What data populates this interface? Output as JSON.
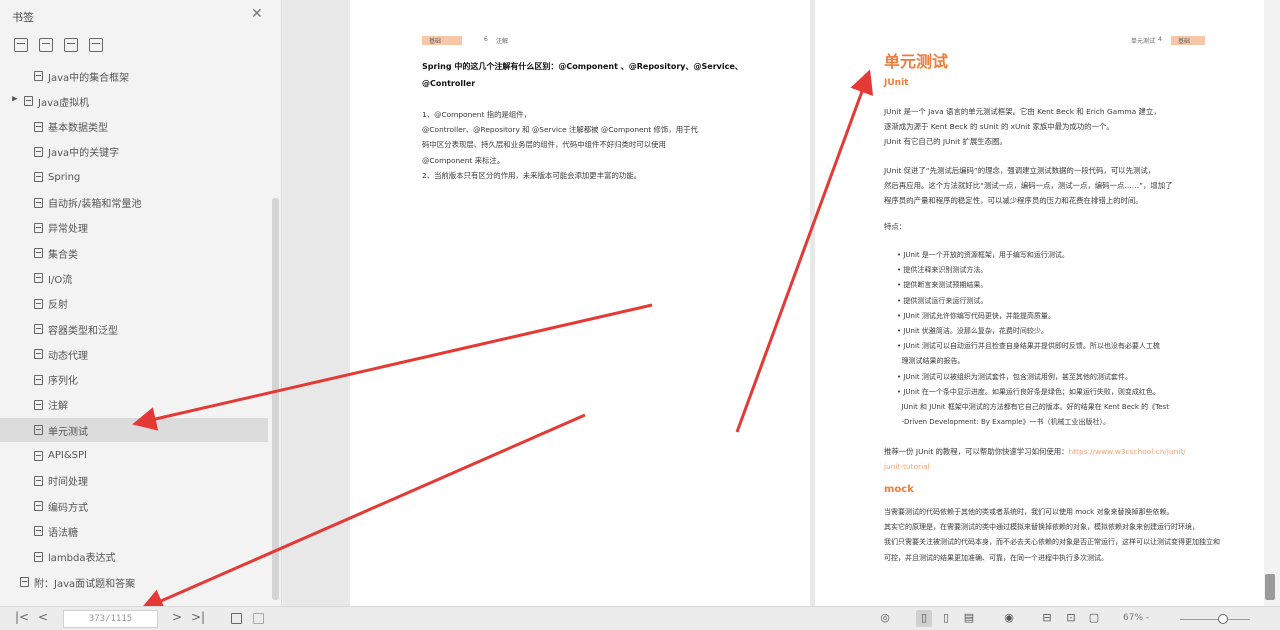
{
  "sidebar": {
    "title": "书签",
    "items": [
      {
        "label": "Java中的集合框架",
        "indent": 1
      },
      {
        "label": "Java虚拟机",
        "indent": 0
      },
      {
        "label": "基本数据类型",
        "indent": 1
      },
      {
        "label": "Java中的关键字",
        "indent": 1
      },
      {
        "label": "Spring",
        "indent": 1
      },
      {
        "label": "自动拆/装箱和常量池",
        "indent": 1
      },
      {
        "label": "异常处理",
        "indent": 1
      },
      {
        "label": "集合类",
        "indent": 1
      },
      {
        "label": "I/O流",
        "indent": 1
      },
      {
        "label": "反射",
        "indent": 1
      },
      {
        "label": "容器类型和泛型",
        "indent": 1
      },
      {
        "label": "动态代理",
        "indent": 1
      },
      {
        "label": "序列化",
        "indent": 1
      },
      {
        "label": "注解",
        "indent": 1
      },
      {
        "label": "单元测试",
        "indent": 1
      },
      {
        "label": "API&SPI",
        "indent": 1
      },
      {
        "label": "时间处理",
        "indent": 1
      },
      {
        "label": "编码方式",
        "indent": 1
      },
      {
        "label": "语法糖",
        "indent": 1
      },
      {
        "label": "lambda表达式",
        "indent": 1
      },
      {
        "label": "附：Java面试题和答案",
        "indent": 0
      }
    ],
    "selected": "单元测试"
  },
  "left_page": {
    "header_tag": "基础",
    "header_page": "6",
    "header_section": "注解",
    "title": "Spring 中的这几个注解有什么区别：@Component 、@Repository、@Service、\n@Controller",
    "body": "1、@Component 指的是组件，\n@Controller、@Repository 和 @Service 注解都被 @Component 修饰，用于代\n码中区分表现层、持久层和业务层的组件，代码中组件不好归类时可以使用\n@Component 来标注。\n2、当前版本只有区分的作用，未来版本可能会添加更丰富的功能。"
  },
  "right_page": {
    "header_text": "单元测试",
    "header_page": "4",
    "header_tag": "基础",
    "heading": "单元测试",
    "subheading": "JUnit",
    "para1": "JUnit 是一个 Java 语言的单元测试框架。它由 Kent Beck 和 Erich Gamma 建立，\n逐渐成为源于 Kent Beck 的 sUnit 的 xUnit 家族中最为成功的一个。\nJUnit 有它自己的 JUnit 扩展生态圈。",
    "para2": "JUnit 促进了“先测试后编码”的理念，强调建立测试数据的一段代码，可以先测试，\n然后再应用。这个方法就好比“测试一点，编码一点，测试一点，编码一点……”，增加了\n程序员的产量和程序的稳定性，可以减少程序员的压力和花费在排错上的时间。",
    "features_label": "特点：",
    "features": "• JUnit 是一个开放的资源框架，用于编写和运行测试。\n• 提供注释来识别测试方法。\n• 提供断言来测试预期结果。\n• 提供测试运行来运行测试。\n• JUnit 测试允许你编写代码更快，并能提高质量。\n• JUnit 优雅简洁。没那么复杂，花费时间较少。\n• JUnit 测试可以自动运行并且检查自身结果并提供即时反馈。所以也没有必要人工梳\n  理测试结果的报告。\n• JUnit 测试可以被组织为测试套件，包含测试用例，甚至其他的测试套件。\n• JUnit 在一个条中显示进度。如果运行良好条是绿色；如果运行失败，则变成红色。\n  JUnit 和 JUnit 框架中测试的方法都有它自己的版本。好的结果在 Kent Beck 的《Test\n  -Driven Development: By Example》一书（机械工业出版社）。",
    "recommend": "推荐一份 JUnit 的教程，可以帮助你快速学习如何使用：",
    "recommend_link": "https://www.w3cschool.cn/junit/",
    "link_cont": "junit-tutorial",
    "mock_heading": "mock",
    "mock_para": "当需要测试的代码依赖于其他的类或者系统时，我们可以使用 mock 对象来替换掉那些依赖。\n其实它的原理是，在需要测试的类中通过模拟来替换掉依赖的对象，模拟依赖对象来创建运行时环境，\n我们只需要关注被测试的代码本身，而不必去关心依赖的对象是否正常运行，这样可以让测试变得更加独立和\n可控，并且测试的结果更加准确、可靠，在同一个进程中执行多次测试。"
  },
  "bottombar": {
    "page_value": "373/1115",
    "zoom": "67% -"
  },
  "colors": {
    "accent": "#f07c3a",
    "arrow": "#e53935",
    "selection": "#dcdcdc"
  }
}
